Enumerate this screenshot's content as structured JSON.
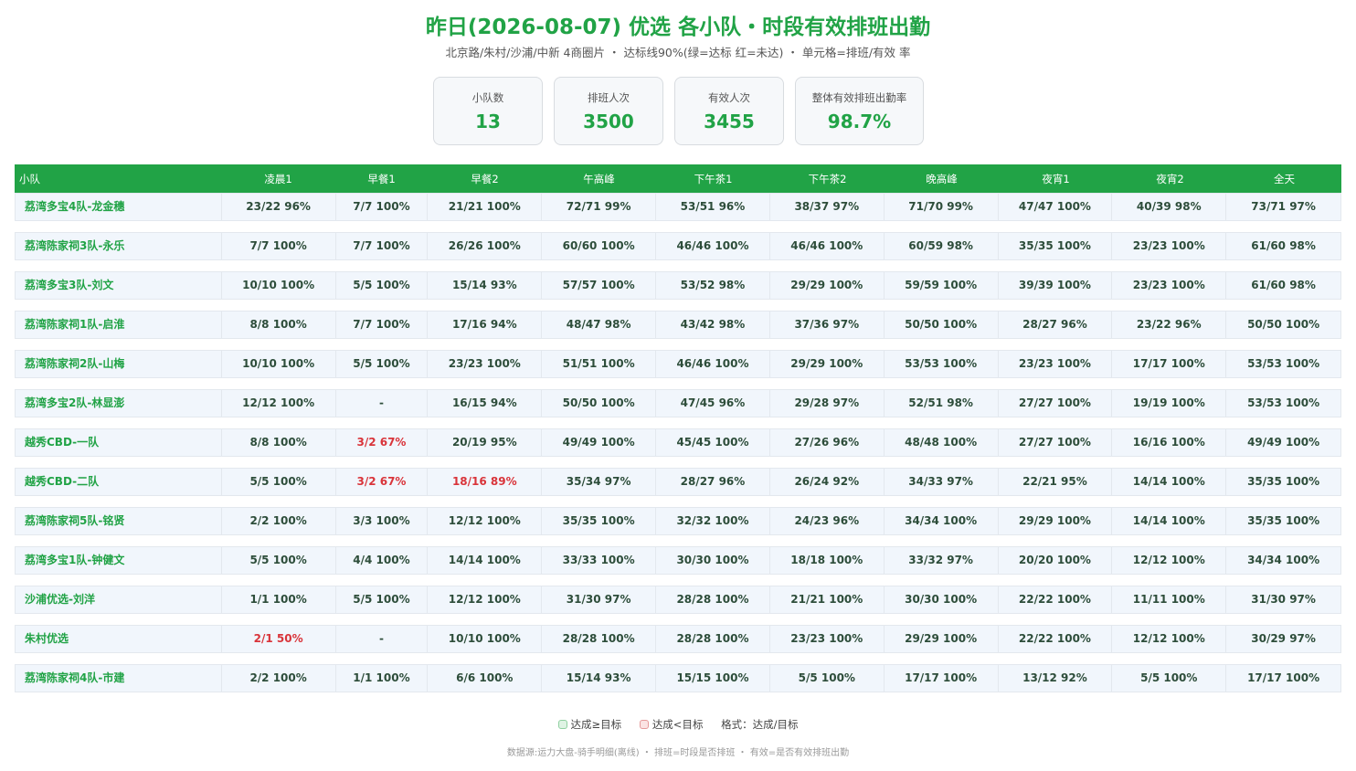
{
  "header": {
    "title": "昨日(2026-08-07) 优选 各小队・时段有效排班出勤",
    "subtitle": "北京路/朱村/沙浦/中新 4商圈片 ・ 达标线90%(绿=达标 红=未达) ・ 单元格=排班/有效 率"
  },
  "kpis": [
    {
      "label": "小队数",
      "value": "13"
    },
    {
      "label": "排班人次",
      "value": "3500"
    },
    {
      "label": "有效人次",
      "value": "3455"
    },
    {
      "label": "整体有效排班出勤率",
      "value": "98.7%"
    }
  ],
  "table": {
    "headers": [
      "小队",
      "凌晨1",
      "早餐1",
      "早餐2",
      "午高峰",
      "下午茶1",
      "下午茶2",
      "晚高峰",
      "夜宵1",
      "夜宵2",
      "全天"
    ],
    "rows": [
      {
        "name": "荔湾多宝4队-龙金穗",
        "cells": [
          "23/22 96%",
          "7/7 100%",
          "21/21 100%",
          "72/71 99%",
          "53/51 96%",
          "38/37 97%",
          "71/70 99%",
          "47/47 100%",
          "40/39 98%",
          "73/71 97%"
        ],
        "red": []
      },
      {
        "name": "荔湾陈家祠3队-永乐",
        "cells": [
          "7/7 100%",
          "7/7 100%",
          "26/26 100%",
          "60/60 100%",
          "46/46 100%",
          "46/46 100%",
          "60/59 98%",
          "35/35 100%",
          "23/23 100%",
          "61/60 98%"
        ],
        "red": []
      },
      {
        "name": "荔湾多宝3队-刘文",
        "cells": [
          "10/10 100%",
          "5/5 100%",
          "15/14 93%",
          "57/57 100%",
          "53/52 98%",
          "29/29 100%",
          "59/59 100%",
          "39/39 100%",
          "23/23 100%",
          "61/60 98%"
        ],
        "red": []
      },
      {
        "name": "荔湾陈家祠1队-启淮",
        "cells": [
          "8/8 100%",
          "7/7 100%",
          "17/16 94%",
          "48/47 98%",
          "43/42 98%",
          "37/36 97%",
          "50/50 100%",
          "28/27 96%",
          "23/22 96%",
          "50/50 100%"
        ],
        "red": []
      },
      {
        "name": "荔湾陈家祠2队-山梅",
        "cells": [
          "10/10 100%",
          "5/5 100%",
          "23/23 100%",
          "51/51 100%",
          "46/46 100%",
          "29/29 100%",
          "53/53 100%",
          "23/23 100%",
          "17/17 100%",
          "53/53 100%"
        ],
        "red": []
      },
      {
        "name": "荔湾多宝2队-林显澎",
        "cells": [
          "12/12 100%",
          "-",
          "16/15 94%",
          "50/50 100%",
          "47/45 96%",
          "29/28 97%",
          "52/51 98%",
          "27/27 100%",
          "19/19 100%",
          "53/53 100%"
        ],
        "red": []
      },
      {
        "name": "越秀CBD-一队",
        "cells": [
          "8/8 100%",
          "3/2 67%",
          "20/19 95%",
          "49/49 100%",
          "45/45 100%",
          "27/26 96%",
          "48/48 100%",
          "27/27 100%",
          "16/16 100%",
          "49/49 100%"
        ],
        "red": [
          1
        ]
      },
      {
        "name": "越秀CBD-二队",
        "cells": [
          "5/5 100%",
          "3/2 67%",
          "18/16 89%",
          "35/34 97%",
          "28/27 96%",
          "26/24 92%",
          "34/33 97%",
          "22/21 95%",
          "14/14 100%",
          "35/35 100%"
        ],
        "red": [
          1,
          2
        ]
      },
      {
        "name": "荔湾陈家祠5队-铭贤",
        "cells": [
          "2/2 100%",
          "3/3 100%",
          "12/12 100%",
          "35/35 100%",
          "32/32 100%",
          "24/23 96%",
          "34/34 100%",
          "29/29 100%",
          "14/14 100%",
          "35/35 100%"
        ],
        "red": []
      },
      {
        "name": "荔湾多宝1队-钟健文",
        "cells": [
          "5/5 100%",
          "4/4 100%",
          "14/14 100%",
          "33/33 100%",
          "30/30 100%",
          "18/18 100%",
          "33/32 97%",
          "20/20 100%",
          "12/12 100%",
          "34/34 100%"
        ],
        "red": []
      },
      {
        "name": "沙浦优选-刘洋",
        "cells": [
          "1/1 100%",
          "5/5 100%",
          "12/12 100%",
          "31/30 97%",
          "28/28 100%",
          "21/21 100%",
          "30/30 100%",
          "22/22 100%",
          "11/11 100%",
          "31/30 97%"
        ],
        "red": []
      },
      {
        "name": "朱村优选",
        "cells": [
          "2/1 50%",
          "-",
          "10/10 100%",
          "28/28 100%",
          "28/28 100%",
          "23/23 100%",
          "29/29 100%",
          "22/22 100%",
          "12/12 100%",
          "30/29 97%"
        ],
        "red": [
          0
        ]
      },
      {
        "name": "荔湾陈家祠4队-市建",
        "cells": [
          "2/2 100%",
          "1/1 100%",
          "6/6 100%",
          "15/14 93%",
          "15/15 100%",
          "5/5 100%",
          "17/17 100%",
          "13/12 92%",
          "5/5 100%",
          "17/17 100%"
        ],
        "red": []
      }
    ]
  },
  "legend": {
    "good_label": "达成≥目标",
    "bad_label": "达成<目标",
    "format_label": "格式：达成/目标",
    "good_color": "#dff3e4",
    "good_border": "#8fd0a0",
    "bad_color": "#fbe3e3",
    "bad_border": "#e59a9a"
  },
  "footer": "数据源:运力大盘-骑手明细(离线) ・ 排班=时段是否排班 ・ 有效=是否有效排班出勤",
  "colors": {
    "accent": "#21a346",
    "red": "#d9343a"
  }
}
